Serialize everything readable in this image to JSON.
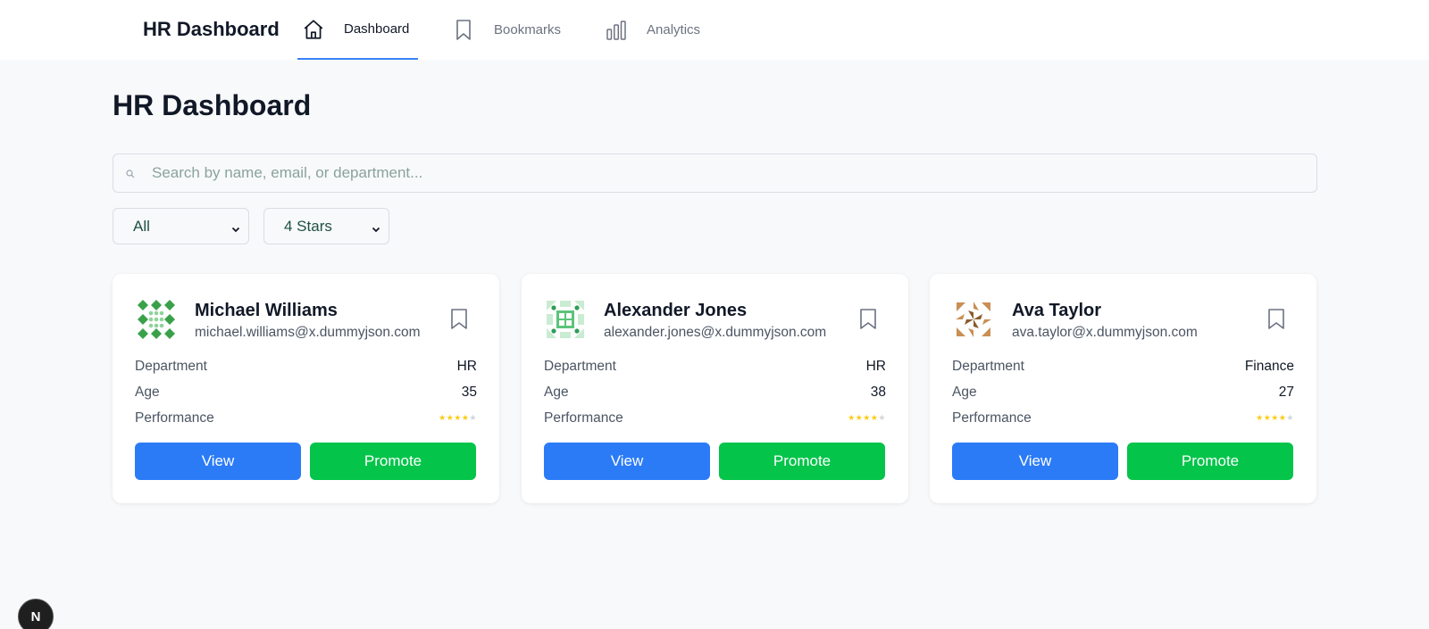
{
  "brand": "HR Dashboard",
  "nav": {
    "items": [
      {
        "label": "Dashboard",
        "icon": "home-icon",
        "active": true
      },
      {
        "label": "Bookmarks",
        "icon": "bookmark-icon",
        "active": false
      },
      {
        "label": "Analytics",
        "icon": "bar-chart-icon",
        "active": false
      }
    ]
  },
  "page_title": "HR Dashboard",
  "search": {
    "placeholder": "Search by name, email, or department...",
    "value": ""
  },
  "filters": {
    "department": {
      "selected": "All"
    },
    "rating": {
      "selected": "4 Stars"
    }
  },
  "cards": [
    {
      "name": "Michael Williams",
      "email": "michael.williams@x.dummyjson.com",
      "department_label": "Department",
      "department": "HR",
      "age_label": "Age",
      "age": "35",
      "performance_label": "Performance",
      "performance_rating": 4,
      "performance_max": 5,
      "view_label": "View",
      "promote_label": "Promote"
    },
    {
      "name": "Alexander Jones",
      "email": "alexander.jones@x.dummyjson.com",
      "department_label": "Department",
      "department": "HR",
      "age_label": "Age",
      "age": "38",
      "performance_label": "Performance",
      "performance_rating": 4,
      "performance_max": 5,
      "view_label": "View",
      "promote_label": "Promote"
    },
    {
      "name": "Ava Taylor",
      "email": "ava.taylor@x.dummyjson.com",
      "department_label": "Department",
      "department": "Finance",
      "age_label": "Age",
      "age": "27",
      "performance_label": "Performance",
      "performance_rating": 4,
      "performance_max": 5,
      "view_label": "View",
      "promote_label": "Promote"
    }
  ],
  "dev_badge": "N",
  "colors": {
    "view_button": "#2b7bf7",
    "promote_button": "#04c44a",
    "active_tab_underline": "#3b82f6",
    "star_filled": "#facc15",
    "star_empty": "#d1d5db"
  }
}
